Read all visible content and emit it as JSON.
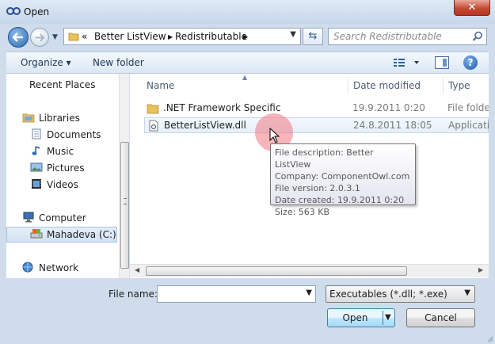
{
  "window": {
    "title": "Open",
    "close_label": "✕"
  },
  "address": {
    "breadcrumb_prefix": "«",
    "crumbs": [
      "Better ListView",
      "Redistributable"
    ],
    "separator": "▶"
  },
  "search": {
    "placeholder": "Search Redistributable"
  },
  "toolbar": {
    "organize_label": "Organize ▾",
    "new_folder_label": "New folder",
    "help_label": "?"
  },
  "nav": {
    "items": [
      {
        "label": "Recent Places"
      },
      {
        "label": "Libraries"
      },
      {
        "label": "Documents"
      },
      {
        "label": "Music"
      },
      {
        "label": "Pictures"
      },
      {
        "label": "Videos"
      },
      {
        "label": "Computer"
      },
      {
        "label": "Mahadeva (C:)"
      },
      {
        "label": "Network"
      }
    ]
  },
  "files": {
    "columns": [
      "Name",
      "Date modified",
      "Type"
    ],
    "rows": [
      {
        "name": ".NET Framework Specific",
        "date": "19.9.2011 0:20",
        "type": "File folder"
      },
      {
        "name": "BetterListView.dll",
        "date": "24.8.2011 18:05",
        "type": "Application"
      }
    ]
  },
  "tooltip": {
    "lines": [
      "File description: Better ListView",
      "Company: ComponentOwl.com",
      "File version: 2.0.3.1",
      "Date created: 19.9.2011 0:20",
      "Size: 563 KB"
    ]
  },
  "bottom": {
    "filename_label": "File name:",
    "filename_value": "",
    "filter_value": "Executables (*.dll; *.exe)",
    "open_label": "Open",
    "cancel_label": "Cancel"
  },
  "colors": {
    "accent": "#3c7fb1",
    "window_frame": "#cfdcec",
    "close_red": "#c74a37"
  }
}
